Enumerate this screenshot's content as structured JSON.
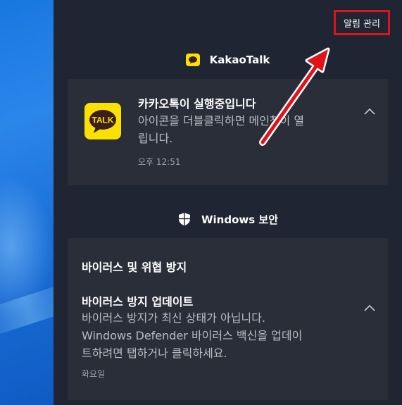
{
  "header": {
    "manage_notifications_label": "알림 관리"
  },
  "groups": [
    {
      "app_name": "KakaoTalk",
      "icon": "kakaotalk-icon",
      "notifications": [
        {
          "title": "카카오톡이 실행중입니다",
          "body_lines": [
            "아이콘을 더블클릭하면 메인창이 열",
            "립니다."
          ],
          "time": "오후 12:51",
          "logo_text": "TALK"
        }
      ]
    },
    {
      "app_name": "Windows 보안",
      "icon": "windows-security-shield-icon",
      "notifications": [
        {
          "heading": "바이러스 및 위협 방지",
          "title": "바이러스 방지 업데이트",
          "body_lines": [
            "바이러스 방지가 최신 상태가 아닙니다.",
            "Windows Defender 바이러스 백신을 업데이",
            "트하려면 탭하거나 클릭하세요."
          ],
          "time": "화요일"
        }
      ]
    }
  ],
  "colors": {
    "panel_bg": "#1f2533",
    "card_bg": "#2a2e38",
    "highlight_red": "#e0131a",
    "kakao_yellow": "#fae100"
  }
}
